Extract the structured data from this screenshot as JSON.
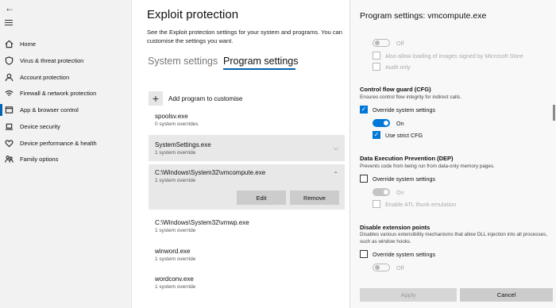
{
  "nav": {
    "back_glyph": "←",
    "items": [
      {
        "label": "Home",
        "icon": "home-icon"
      },
      {
        "label": "Virus & threat protection",
        "icon": "shield-icon"
      },
      {
        "label": "Account protection",
        "icon": "person-icon"
      },
      {
        "label": "Firewall & network protection",
        "icon": "wifi-icon"
      },
      {
        "label": "App & browser control",
        "icon": "app-window-icon",
        "active": true
      },
      {
        "label": "Device security",
        "icon": "laptop-icon"
      },
      {
        "label": "Device performance & health",
        "icon": "heart-icon"
      },
      {
        "label": "Family options",
        "icon": "family-icon"
      }
    ]
  },
  "main": {
    "title": "Exploit protection",
    "description_line1": "See the Exploit protection settings for your system and programs. You can",
    "description_line2": "customise the settings you want.",
    "tabs": [
      {
        "label": "System settings",
        "selected": false
      },
      {
        "label": "Program settings",
        "selected": true
      }
    ],
    "add_program_label": "Add program to customise",
    "programs": [
      {
        "name": "spoolsv.exe",
        "overrides": "0 system overrides"
      },
      {
        "name": "SystemSettings.exe",
        "overrides": "1 system override"
      },
      {
        "name": "C:\\Windows\\System32\\vmcompute.exe",
        "overrides": "1 system override"
      },
      {
        "name": "C:\\Windows\\System32\\vmwp.exe",
        "overrides": "1 system override"
      },
      {
        "name": "winword.exe",
        "overrides": "1 system override"
      },
      {
        "name": "wordconv.exe",
        "overrides": "1 system override"
      }
    ],
    "edit_label": "Edit",
    "remove_label": "Remove"
  },
  "flyout": {
    "title": "Program settings: vmcompute.exe",
    "top_toggle_label": "Off",
    "also_allow_label": "Also allow loading of images signed by Microsoft Store",
    "audit_only_label": "Audit only",
    "cfg": {
      "heading": "Control flow guard (CFG)",
      "description": "Ensures control flow integrity for indirect calls.",
      "override_label": "Override system settings",
      "toggle_label": "On",
      "strict_label": "Use strict CFG"
    },
    "dep": {
      "heading": "Data Execution Prevention (DEP)",
      "description": "Prevents code from being run from data-only memory pages.",
      "override_label": "Override system settings",
      "toggle_label": "On",
      "atl_label": "Enable ATL thunk emulation"
    },
    "dep_ext": {
      "heading": "Disable extension points",
      "description_line1": "Disables various extensibility mechanisms that allow DLL injection into all processes,",
      "description_line2": "such as window hooks.",
      "override_label": "Override system settings",
      "toggle_label": "Off"
    },
    "apply_label": "Apply",
    "cancel_label": "Cancel"
  }
}
